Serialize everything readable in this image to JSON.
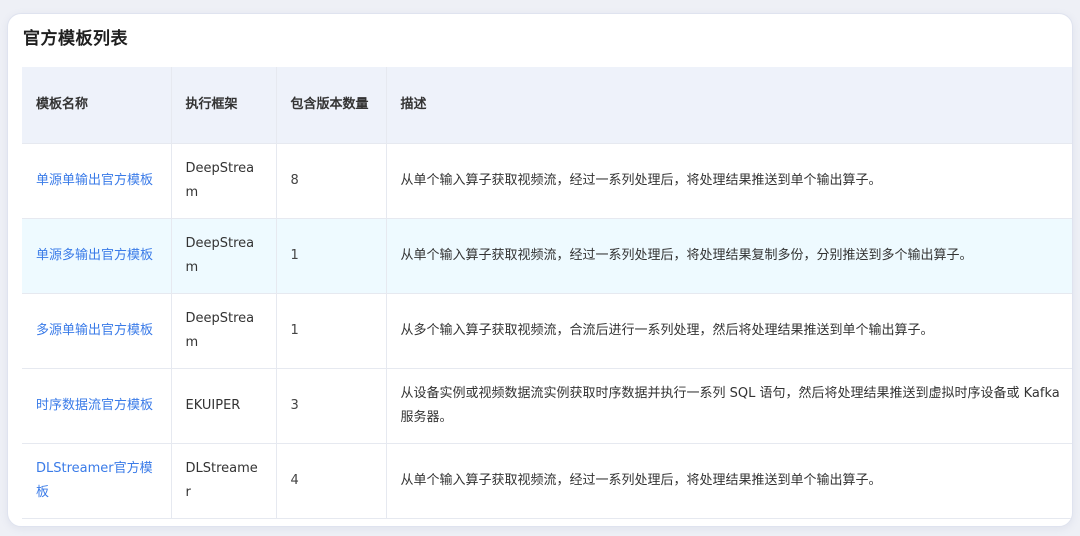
{
  "title": "官方模板列表",
  "table": {
    "headers": [
      "模板名称",
      "执行框架",
      "包含版本数量",
      "描述"
    ],
    "rows": [
      {
        "name": "单源单输出官方模板",
        "framework": "DeepStream",
        "versions": "8",
        "description": "从单个输入算子获取视频流，经过一系列处理后，将处理结果推送到单个输出算子。"
      },
      {
        "name": "单源多输出官方模板",
        "framework": "DeepStream",
        "versions": "1",
        "description": "从单个输入算子获取视频流，经过一系列处理后，将处理结果复制多份，分别推送到多个输出算子。"
      },
      {
        "name": "多源单输出官方模板",
        "framework": "DeepStream",
        "versions": "1",
        "description": "从多个输入算子获取视频流，合流后进行一系列处理，然后将处理结果推送到单个输出算子。"
      },
      {
        "name": "时序数据流官方模板",
        "framework": "EKUIPER",
        "versions": "3",
        "description": "从设备实例或视频数据流实例获取时序数据并执行一系列 SQL 语句，然后将处理结果推送到虚拟时序设备或 Kafka 服务器。"
      },
      {
        "name": "DLStreamer官方模板",
        "framework": "DLStreamer",
        "versions": "4",
        "description": "从单个输入算子获取视频流，经过一系列处理后，将处理结果推送到单个输出算子。"
      }
    ]
  }
}
